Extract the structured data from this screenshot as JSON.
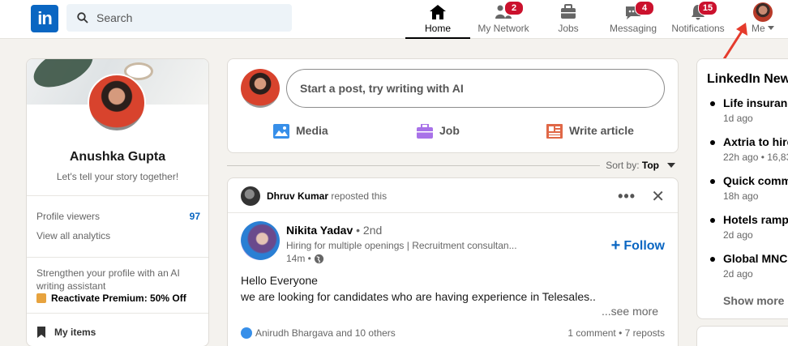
{
  "nav": {
    "logo": "in",
    "search_placeholder": "Search",
    "items": [
      {
        "label": "Home",
        "icon": "home-icon",
        "badge": ""
      },
      {
        "label": "My Network",
        "icon": "network-icon",
        "badge": "2"
      },
      {
        "label": "Jobs",
        "icon": "jobs-icon",
        "badge": ""
      },
      {
        "label": "Messaging",
        "icon": "messaging-icon",
        "badge": "4"
      },
      {
        "label": "Notifications",
        "icon": "bell-icon",
        "badge": "15"
      },
      {
        "label": "Me",
        "icon": "avatar",
        "badge": ""
      }
    ],
    "active": "Home"
  },
  "profile": {
    "name": "Anushka Gupta",
    "tagline": "Let's tell your story together!",
    "viewers_label": "Profile viewers",
    "viewers_count": "97",
    "analytics_label": "View all analytics",
    "promo_text": "Strengthen your profile with an AI writing assistant",
    "premium_label": "Reactivate Premium: 50% Off",
    "my_items": "My items"
  },
  "share": {
    "placeholder": "Start a post, try writing with AI",
    "media": "Media",
    "job": "Job",
    "article": "Write article"
  },
  "sort": {
    "label": "Sort by:",
    "value": "Top"
  },
  "post": {
    "reposter": "Dhruv Kumar",
    "repost_text": "reposted this",
    "author": "Nikita Yadav",
    "degree": "• 2nd",
    "headline": "Hiring for multiple openings | Recruitment consultan...",
    "time": "14m •",
    "follow": "Follow",
    "body_line1": "Hello Everyone",
    "body_line2": "we are looking for candidates who are having experience in Telesales..",
    "see_more": "...see more",
    "reactions": "Anirudh Bhargava and 10 others",
    "engagement": "1 comment • 7 reposts"
  },
  "news": {
    "title": "LinkedIn News",
    "items": [
      {
        "headline": "Life insurance",
        "meta": "1d ago"
      },
      {
        "headline": "Axtria to hire",
        "meta": "22h ago • 16,83"
      },
      {
        "headline": "Quick comm",
        "meta": "18h ago"
      },
      {
        "headline": "Hotels ramp",
        "meta": "2d ago"
      },
      {
        "headline": "Global MNCs",
        "meta": "2d ago"
      }
    ],
    "show_more": "Show more"
  },
  "colors": {
    "brand": "#0a66c2",
    "badge": "#cb112d",
    "annotation": "#e53b2c"
  }
}
